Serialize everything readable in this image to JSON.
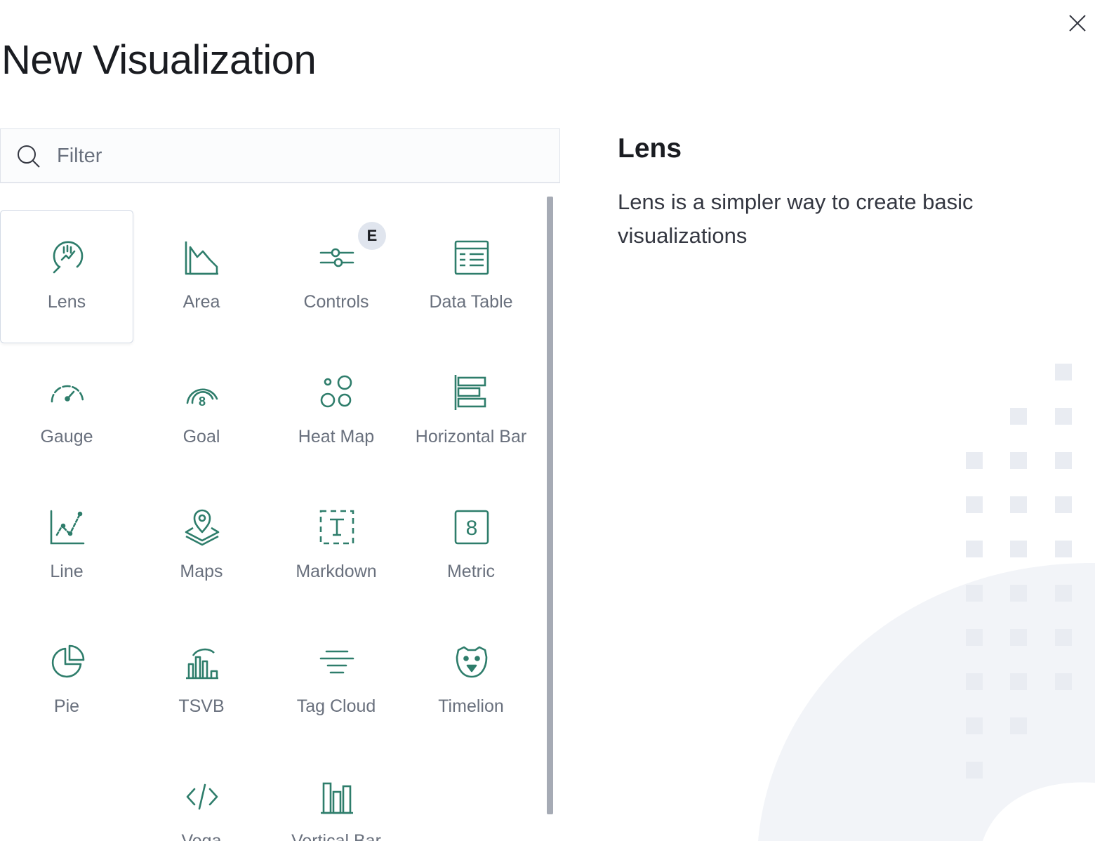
{
  "flyout": {
    "title": "New Visualization",
    "close_label": "Close"
  },
  "search": {
    "placeholder": "Filter"
  },
  "grid": {
    "items": [
      {
        "label": "Lens",
        "icon": "lens-icon",
        "selected": true
      },
      {
        "label": "Area",
        "icon": "area-chart-icon"
      },
      {
        "label": "Controls",
        "icon": "controls-icon",
        "badge": "E"
      },
      {
        "label": "Data Table",
        "icon": "data-table-icon"
      },
      {
        "label": "Gauge",
        "icon": "gauge-icon"
      },
      {
        "label": "Goal",
        "icon": "goal-icon"
      },
      {
        "label": "Heat Map",
        "icon": "heat-map-icon"
      },
      {
        "label": "Horizontal Bar",
        "icon": "horizontal-bar-icon"
      },
      {
        "label": "Line",
        "icon": "line-chart-icon"
      },
      {
        "label": "Maps",
        "icon": "maps-icon"
      },
      {
        "label": "Markdown",
        "icon": "markdown-icon"
      },
      {
        "label": "Metric",
        "icon": "metric-icon"
      },
      {
        "label": "Pie",
        "icon": "pie-chart-icon"
      },
      {
        "label": "TSVB",
        "icon": "tsvb-icon"
      },
      {
        "label": "Tag Cloud",
        "icon": "tag-cloud-icon"
      },
      {
        "label": "Timelion",
        "icon": "timelion-icon"
      },
      {
        "label": "Vega",
        "icon": "vega-icon"
      },
      {
        "label": "Vertical Bar",
        "icon": "vertical-bar-icon"
      }
    ]
  },
  "description": {
    "title": "Lens",
    "text": "Lens is a simpler way to create basic visualizations"
  },
  "colors": {
    "icon": "#2e7d6b",
    "label": "#69707d",
    "selected_border": "#d3dae6",
    "scrollbar": "#a6abb5"
  }
}
